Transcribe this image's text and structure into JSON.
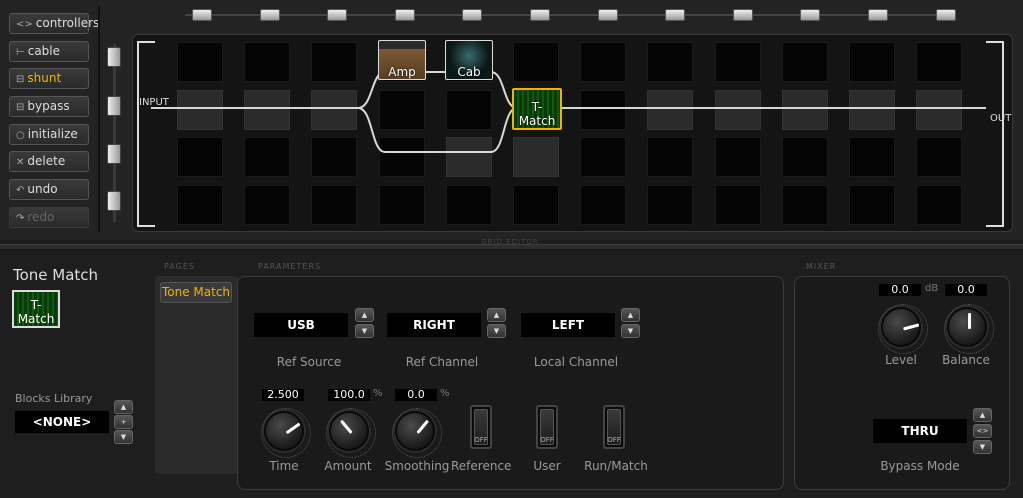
{
  "toolbar": {
    "controllers": "controllers",
    "cable": "cable",
    "shunt": "shunt",
    "bypass": "bypass",
    "initialize": "initialize",
    "delete": "delete",
    "undo": "undo",
    "redo": "redo",
    "icons": [
      "swap-icon",
      "cable-icon",
      "shunt-icon",
      "bypass-icon",
      "circle-icon",
      "x-icon",
      "undo-icon",
      "redo-icon"
    ]
  },
  "grid": {
    "input_label": "INPUT",
    "output_label": "OUT",
    "footer_label": "GRID EDITOR",
    "blocks": {
      "amp": "Amp",
      "cab": "Cab",
      "tone_match": "T-Match"
    }
  },
  "bottom": {
    "block_title": "Tone Match",
    "block_icon_label": "T-Match",
    "blocks_library": {
      "label": "Blocks Library",
      "value": "<NONE>"
    },
    "pages_label": "PAGES",
    "pages": [
      {
        "label": "Tone Match",
        "active": true
      }
    ],
    "parameters_label": "PARAMETERS",
    "mixer_label": "MIXER",
    "selectors": [
      {
        "value": "USB",
        "label": "Ref Source"
      },
      {
        "value": "RIGHT",
        "label": "Ref Channel"
      },
      {
        "value": "LEFT",
        "label": "Local Channel"
      }
    ],
    "knobs": [
      {
        "value": "2.500",
        "label": "Time",
        "unit": ""
      },
      {
        "value": "100.0",
        "label": "Amount",
        "unit": "%"
      },
      {
        "value": "0.0",
        "label": "Smoothing",
        "unit": "%"
      }
    ],
    "switches": [
      {
        "label": "Reference",
        "state": "OFF"
      },
      {
        "label": "User",
        "state": "OFF"
      },
      {
        "label": "Run/Match",
        "state": "OFF"
      }
    ],
    "mixer": {
      "level": {
        "value": "0.0",
        "unit": "dB",
        "label": "Level"
      },
      "balance": {
        "value": "0.0",
        "label": "Balance"
      },
      "bypass_mode": {
        "value": "THRU",
        "label": "Bypass Mode"
      }
    }
  },
  "colors": {
    "accent": "#f0b400",
    "background": "#1e1e1e"
  }
}
